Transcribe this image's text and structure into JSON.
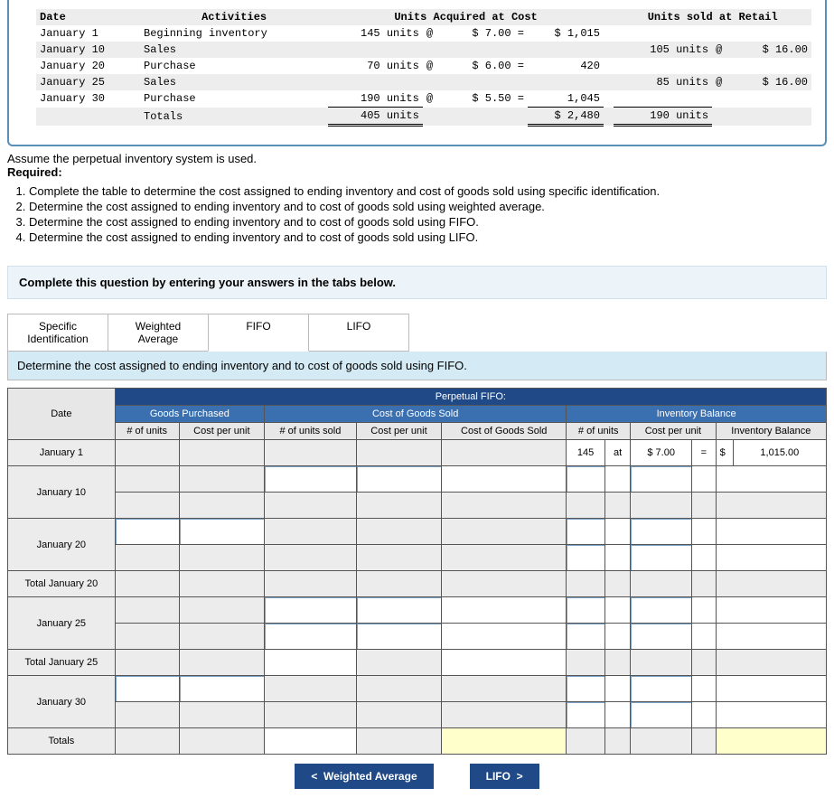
{
  "top": {
    "headers": [
      "Date",
      "Activities",
      "Units Acquired at Cost",
      "Units sold at Retail"
    ],
    "rows": [
      {
        "date": "January 1",
        "activity": "Beginning inventory",
        "units": "145 units",
        "at": "@",
        "cost": "$ 7.00 =",
        "total": "$ 1,015",
        "sold_units": "",
        "sold_at": "",
        "sold_price": ""
      },
      {
        "date": "January 10",
        "activity": "Sales",
        "units": "",
        "at": "",
        "cost": "",
        "total": "",
        "sold_units": "105 units",
        "sold_at": "@",
        "sold_price": "$ 16.00"
      },
      {
        "date": "January 20",
        "activity": "Purchase",
        "units": "70 units",
        "at": "@",
        "cost": "$ 6.00 =",
        "total": "420",
        "sold_units": "",
        "sold_at": "",
        "sold_price": ""
      },
      {
        "date": "January 25",
        "activity": "Sales",
        "units": "",
        "at": "",
        "cost": "",
        "total": "",
        "sold_units": "85 units",
        "sold_at": "@",
        "sold_price": "$ 16.00"
      },
      {
        "date": "January 30",
        "activity": "Purchase",
        "units": "190 units",
        "at": "@",
        "cost": "$ 5.50 =",
        "total": "1,045",
        "sold_units": "",
        "sold_at": "",
        "sold_price": ""
      }
    ],
    "totals": {
      "label": "Totals",
      "units": "405 units",
      "sum": "$ 2,480",
      "sold_units": "190 units"
    }
  },
  "assume": "Assume the perpetual inventory system is used.",
  "required_label": "Required:",
  "req": [
    "Complete the table to determine the cost assigned to ending inventory and cost of goods sold using specific identification.",
    "Determine the cost assigned to ending inventory and to cost of goods sold using weighted average.",
    "Determine the cost assigned to ending inventory and to cost of goods sold using FIFO.",
    "Determine the cost assigned to ending inventory and to cost of goods sold using LIFO."
  ],
  "instr": "Complete this question by entering your answers in the tabs below.",
  "tabs": [
    "Specific Identification",
    "Weighted Average",
    "FIFO",
    "LIFO"
  ],
  "tab_desc": "Determine the cost assigned to ending inventory and to cost of goods sold using FIFO.",
  "fifo": {
    "title": "Perpetual FIFO:",
    "sections": [
      "Goods Purchased",
      "Cost of Goods Sold",
      "Inventory Balance"
    ],
    "cols": [
      "Date",
      "# of units",
      "Cost per unit",
      "# of units sold",
      "Cost per unit",
      "Cost of Goods Sold",
      "# of units",
      "Cost per unit",
      "Inventory Balance"
    ],
    "rows": [
      "January 1",
      "January 10",
      "January 20",
      "Total January 20",
      "January 25",
      "Total January 25",
      "January 30",
      "Totals"
    ],
    "jan1": {
      "units": "145",
      "at": "at",
      "cost": "$ 7.00",
      "eq": "=",
      "bal_cur": "$",
      "bal": "1,015.00"
    }
  },
  "nav": {
    "prev": "Weighted Average",
    "next": "LIFO"
  },
  "glyph": {
    "left": "<",
    "right": ">"
  }
}
